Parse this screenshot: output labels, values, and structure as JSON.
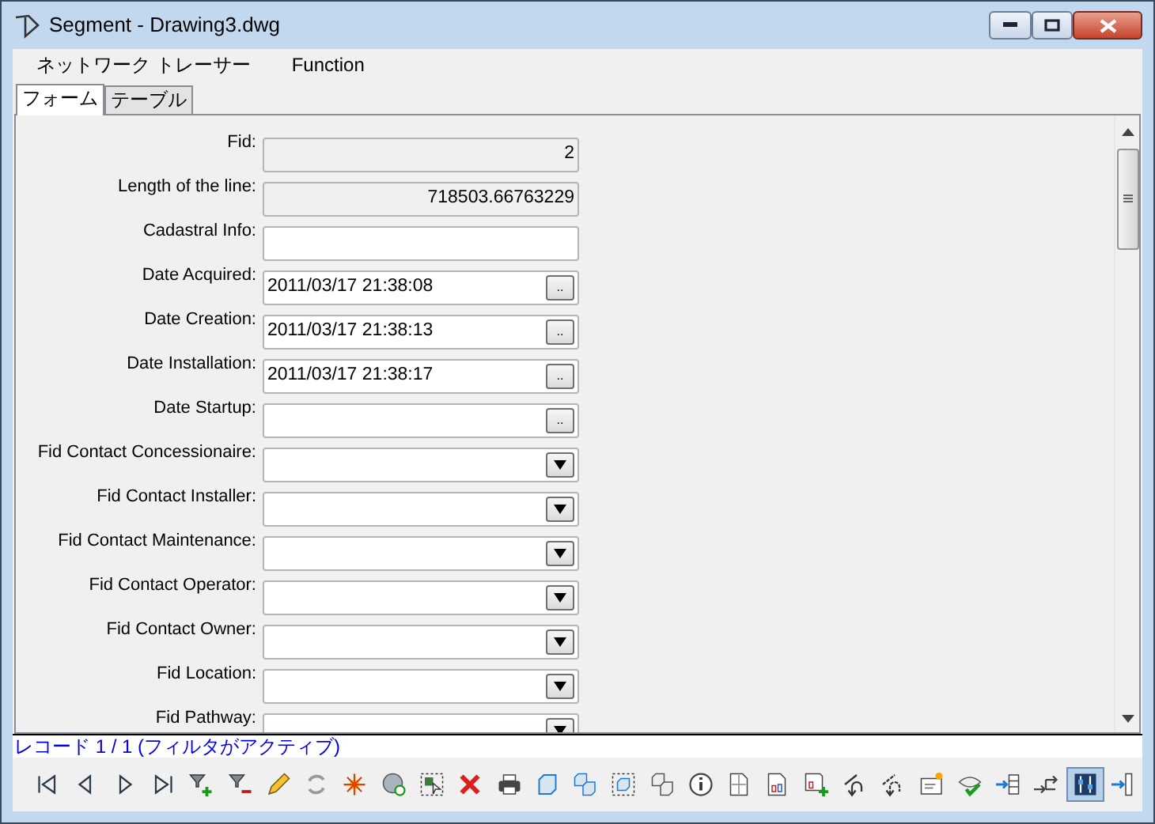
{
  "window": {
    "title": "Segment - Drawing3.dwg"
  },
  "menu": [
    "ネットワーク トレーサー",
    "Function"
  ],
  "tabs": [
    {
      "label": "フォーム",
      "selected": true
    },
    {
      "label": "テーブル",
      "selected": false
    }
  ],
  "fields": [
    {
      "label": "Fid:",
      "kind": "readonly",
      "value": "2"
    },
    {
      "label": "Length of the line:",
      "kind": "readonly",
      "value": "718503.66763229"
    },
    {
      "label": "Cadastral Info:",
      "kind": "text"
    },
    {
      "label": "Date Acquired:",
      "kind": "date",
      "value": "2011/03/17 21:38:08",
      "button": ".."
    },
    {
      "label": "Date Creation:",
      "kind": "date",
      "value": "2011/03/17 21:38:13",
      "button": ".."
    },
    {
      "label": "Date Installation:",
      "kind": "date",
      "value": "2011/03/17 21:38:17",
      "button": ".."
    },
    {
      "label": "Date Startup:",
      "kind": "date",
      "button": ".."
    },
    {
      "label": "Fid Contact Concessionaire:",
      "kind": "combo"
    },
    {
      "label": "Fid Contact Installer:",
      "kind": "combo"
    },
    {
      "label": "Fid Contact Maintenance:",
      "kind": "combo"
    },
    {
      "label": "Fid Contact Operator:",
      "kind": "combo"
    },
    {
      "label": "Fid Contact Owner:",
      "kind": "combo"
    },
    {
      "label": "Fid Location:",
      "kind": "combo"
    },
    {
      "label": "Fid Pathway:",
      "kind": "combo"
    }
  ],
  "status": "レコード 1 / 1 (フィルタがアクティブ)",
  "toolbar": [
    {
      "selected": false
    },
    {
      "selected": false
    },
    {
      "selected": false
    },
    {
      "selected": false
    },
    {
      "selected": false
    },
    {
      "selected": false
    },
    {
      "selected": false
    },
    {
      "selected": false
    },
    {
      "selected": false
    },
    {
      "selected": false
    },
    {
      "selected": false
    },
    {
      "selected": false
    },
    {
      "selected": false
    },
    {
      "selected": false
    },
    {
      "selected": false
    },
    {
      "selected": false
    },
    {
      "selected": false
    },
    {
      "selected": false
    },
    {
      "selected": false
    },
    {
      "selected": false
    },
    {
      "selected": false
    },
    {
      "selected": false
    },
    {
      "selected": false
    },
    {
      "selected": false
    },
    {
      "selected": false
    },
    {
      "selected": false
    },
    {
      "selected": false
    },
    {
      "selected": true
    },
    {
      "selected": false
    }
  ]
}
